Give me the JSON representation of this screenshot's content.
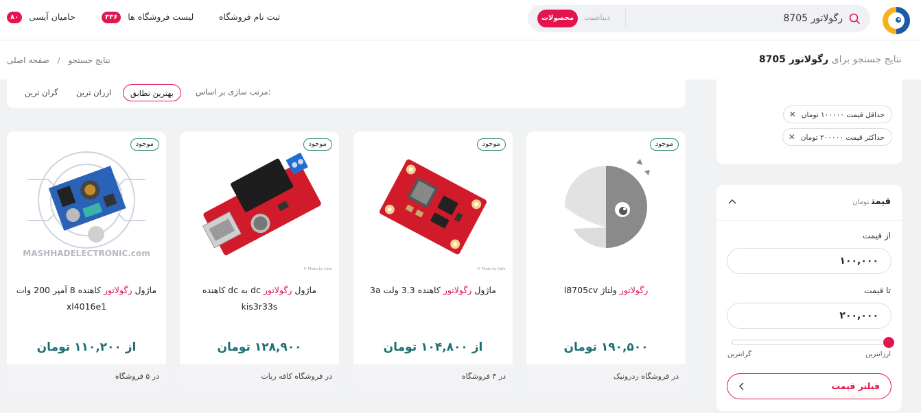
{
  "header": {
    "search": {
      "value": "رگولاتور 8705",
      "tab_datasheet": "دیتاشیت",
      "tab_products": "محصولات"
    },
    "nav": {
      "register_shop": "ثبت نام فروشگاه",
      "shops_list": "لیست فروشگاه ها",
      "shops_count": "۳۳۶",
      "supporters": "حامیان آیسی",
      "supporters_count": "۸۰"
    }
  },
  "titlebar": {
    "title_prefix": "نتایج جستجو برای",
    "query": "رگولاتور 8705",
    "breadcrumb": {
      "home": "صفحه اصلی",
      "separator": "/",
      "current": "نتایج جستجو"
    }
  },
  "sort": {
    "label": "مرتب سازی بر اساس:",
    "best_match": "بهترین تطابق",
    "cheapest": "ارزان ترین",
    "most_expensive": "گران ترین"
  },
  "products": [
    {
      "stock": "موجود",
      "name_keyword": "رگولاتور",
      "name_rest": " ولتاژ l8705cv",
      "price": "۱۹۰,۵۰۰ تومان",
      "shop": "در فروشگاه ردرونیک",
      "image": "parrot-placeholder-icon"
    },
    {
      "stock": "موجود",
      "name_prefix": "ماژول ",
      "name_keyword": "رگولاتور",
      "name_rest": " کاهنده 3.3 ولت 3a",
      "price": "از ۱۰۴,۸۰۰ تومان",
      "shop": "در ۳ فروشگاه",
      "image": "red-buck-module-photo"
    },
    {
      "stock": "موجود",
      "name_prefix": "ماژول ",
      "name_keyword": "رگولاتور",
      "name_rest": " dc به dc کاهنده kis3r33s",
      "price": "۱۲۸,۹۰۰ تومان",
      "shop": "در فروشگاه کافه ربات",
      "image": "usb-buck-module-photo"
    },
    {
      "stock": "موجود",
      "name_prefix": "ماژول ",
      "name_keyword": "رگولاتور",
      "name_rest": " کاهنده 8 آمپر 200 وات xl4016e1",
      "price": "از ۱۱۰,۲۰۰ تومان",
      "shop": "در ۵ فروشگاه",
      "image": "xl4016-module-photo",
      "image_watermark": "MASHHADELECTRONIC.com"
    }
  ],
  "filters": {
    "min_chip": "حداقل قیمت ۱۰۰۰۰۰ تومان",
    "max_chip": "حداکثر قیمت ۲۰۰۰۰۰ تومان",
    "chip_close": "✕"
  },
  "price_filter": {
    "title": "قیمت",
    "unit": "تومان",
    "from_label": "از قیمت",
    "from_value": "۱۰۰,۰۰۰",
    "to_label": "تا قیمت",
    "to_value": "۲۰۰,۰۰۰",
    "slider_left": "گرانترین",
    "slider_right": "ارزانترین",
    "button": "فیلتر قیمت"
  },
  "colors": {
    "accent": "#e4144f",
    "price": "#1d6f73",
    "stock_border": "#2a8c5a",
    "background": "#f1f2f4"
  }
}
